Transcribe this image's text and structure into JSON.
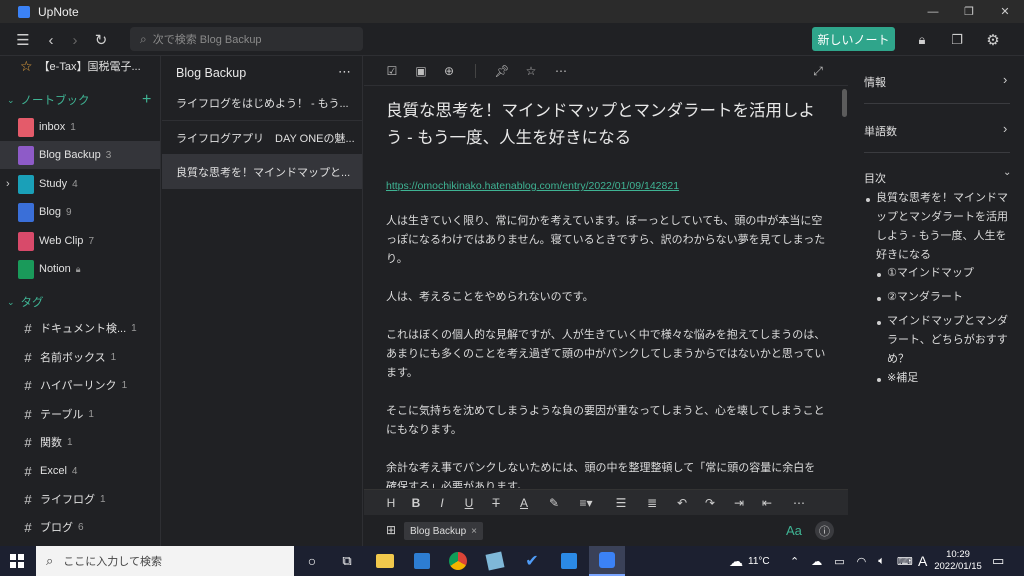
{
  "window": {
    "title": "UpNote"
  },
  "toolbar": {
    "search_placeholder": "次で検索 Blog Backup",
    "new_note": "新しいノート"
  },
  "sidebar": {
    "pinned": "【e-Tax】国税電子...",
    "notebooks_header": "ノートブック",
    "notebooks": [
      {
        "label": "inbox",
        "count": "1",
        "color": "#e45b6a"
      },
      {
        "label": "Blog Backup",
        "count": "3",
        "color": "#8e5bc8"
      },
      {
        "label": "Study",
        "count": "4",
        "color": "#1aa0b8"
      },
      {
        "label": "Blog",
        "count": "9",
        "color": "#3a6fd8"
      },
      {
        "label": "Web Clip",
        "count": "7",
        "color": "#d84a6a"
      },
      {
        "label": "Notion",
        "count": "",
        "color": "#1a9a5a"
      }
    ],
    "tags_header": "タグ",
    "tags": [
      {
        "label": "ドキュメント検...",
        "count": "1"
      },
      {
        "label": "名前ボックス",
        "count": "1"
      },
      {
        "label": "ハイパーリンク",
        "count": "1"
      },
      {
        "label": "テーブル",
        "count": "1"
      },
      {
        "label": "関数",
        "count": "1"
      },
      {
        "label": "Excel",
        "count": "4"
      },
      {
        "label": "ライフログ",
        "count": "1"
      },
      {
        "label": "ブログ",
        "count": "6"
      }
    ]
  },
  "notelist": {
    "title": "Blog Backup",
    "items": [
      "ライフログをはじめよう！ - もう...",
      "ライフログアプリ　DAY ONEの魅...",
      "良質な思考を！マインドマップと..."
    ]
  },
  "editor": {
    "title": "良質な思考を！マインドマップとマンダラートを活用しよう - もう一度、人生を好きになる",
    "link": "https://omochikinako.hatenablog.com/entry/2022/01/09/142821",
    "paragraphs": [
      "人は生きていく限り、常に何かを考えています。ぼーっとしていても、頭の中が本当に空っぽになるわけではありません。寝ているときですら、訳のわからない夢を見てしまったり。",
      "人は、考えることをやめられないのです。",
      "これはぼくの個人的な見解ですが、人が生きていく中で様々な悩みを抱えてしまうのは、あまりにも多くのことを考え過ぎて頭の中がパンクしてしまうからではないかと思っています。",
      "そこに気持ちを沈めてしまうような負の要因が重なってしまうと、心を壊してしまうことにもなります。",
      "余計な考え事でパンクしないためには、頭の中を整理整頓して「常に頭の容量に余白を確保する」必要があります。"
    ],
    "tag_chip": "Blog Backup",
    "font_button": "Aa"
  },
  "rpanel": {
    "info": "情報",
    "wordcount": "単語数",
    "toc_header": "目次",
    "toc_main": "良質な思考を！マインドマップとマンダラートを活用しよう - もう一度、人生を好きになる",
    "toc_items": [
      "①マインドマップ",
      "②マンダラート",
      "マインドマップとマンダラート、どちらがおすすめ？",
      "※補足"
    ]
  },
  "taskbar": {
    "search": "ここに入力して検索",
    "temp": "11°C",
    "time": "10:29",
    "date": "2022/01/15",
    "ime": "A"
  },
  "colors": {
    "accent": "#2fa58b",
    "background": "#202124"
  }
}
